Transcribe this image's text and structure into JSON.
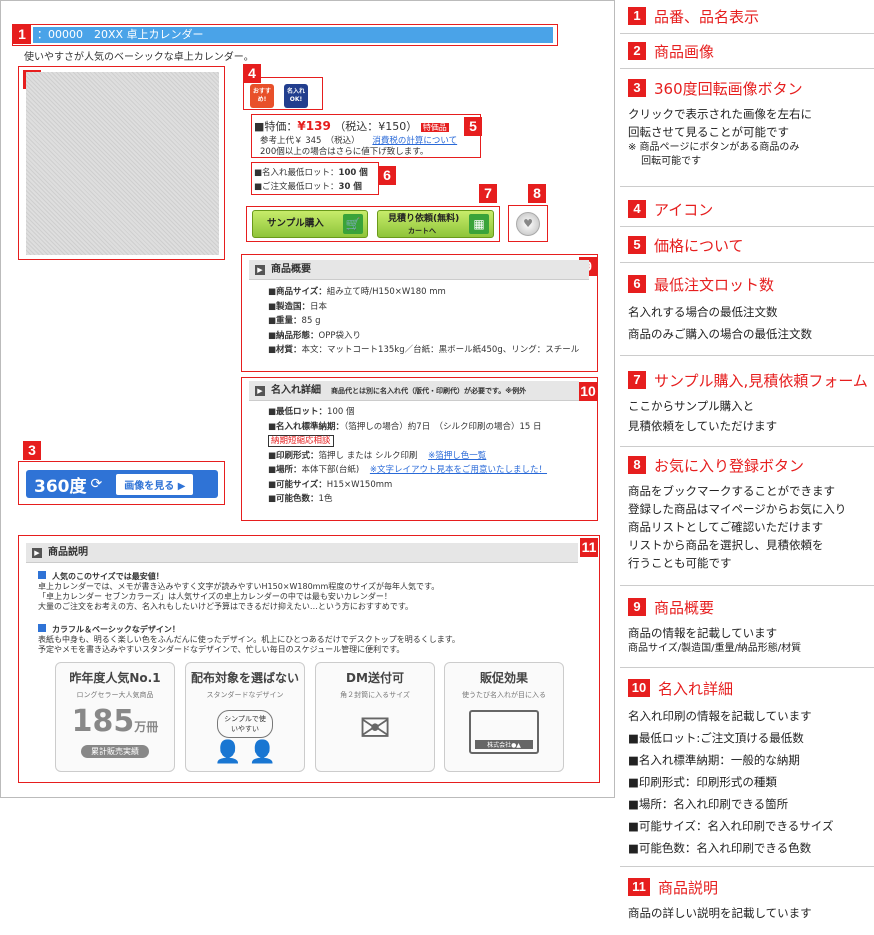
{
  "product": {
    "title": "：00000　20XX 卓上カレンダー",
    "subtitle": "使いやすさが人気のベーシックな卓上カレンダー。",
    "icons": [
      {
        "name": "osusume",
        "text": "おすすめ!"
      },
      {
        "name": "naire-ok",
        "text": "名入れOK!"
      }
    ],
    "price": {
      "label": "■特価：",
      "value": "¥139",
      "tax": "（税込：¥150）",
      "badge": "特価品",
      "ref": "参考上代￥ 345　（税込）",
      "link": "消費税の計算について",
      "note": "200個以上の場合はさらに値下げ致します。"
    },
    "lot": {
      "line1_label": "■名入れ最低ロット：",
      "line1_value": "100 個",
      "line2_label": "■ご注文最低ロット：",
      "line2_value": "30 個"
    },
    "sample_button": "サンプル購入",
    "estimate_button_l1": "見積り依頼(無料)",
    "estimate_button_l2": "カートへ",
    "rotate": {
      "degree": "360度",
      "link": "画像を見る ▶"
    },
    "overview": {
      "heading": "商品概要",
      "rows": [
        {
          "k": "■商品サイズ：",
          "v": "組み立て時/H150×W180 mm"
        },
        {
          "k": "■製造国：",
          "v": "日本"
        },
        {
          "k": "■重量：",
          "v": "85 g"
        },
        {
          "k": "■納品形態：",
          "v": "OPP袋入り"
        },
        {
          "k": "■材質：",
          "v": "本文：マットコート135kg／台紙：黒ボール紙450g、リング：スチール"
        }
      ]
    },
    "naire": {
      "heading": "名入れ詳細",
      "heading_note": "商品代とは別に名入れ代（版代・印刷代）が必要です。※例外",
      "rows": [
        {
          "k": "■最低ロット：",
          "v": "100 個"
        },
        {
          "k": "■名入れ標準納期：",
          "v": "（箔押しの場合）約7日　（シルク印刷の場合）15 日"
        },
        {
          "k": "",
          "v": "納期短縮応相談"
        },
        {
          "k": "■印刷形式：",
          "v": "箔押し または シルク印刷",
          "link": "※箔押し色一覧"
        },
        {
          "k": "■場所：",
          "v": "本体下部(台紙)",
          "link": "※文字レイアウト見本をご用意いたしました！"
        },
        {
          "k": "■可能サイズ：",
          "v": "H15×W150mm"
        },
        {
          "k": "■可能色数：",
          "v": "1色"
        }
      ]
    },
    "description": {
      "heading": "商品説明",
      "p1_title": "人気のこのサイズでは最安値！",
      "p1_lines": [
        "卓上カレンダーでは、メモが書き込みやすく文字が読みやすいH150×W180mm程度のサイズが毎年人気です。",
        "「卓上カレンダー セブンカラーズ」は人気サイズの卓上カレンダーの中では最も安いカレンダー！",
        "大量のご注文をお考えの方、名入れもしたいけど予算はできるだけ抑えたい…という方におすすめです。"
      ],
      "p2_title": "カラフル＆ベーシックなデザイン！",
      "p2_lines": [
        "表紙も中身も、明るく楽しい色をふんだんに使ったデザイン。机上にひとつあるだけでデスクトップを明るくします。",
        "予定やメモを書き込みやすいスタンダードなデザインで、忙しい毎日のスケジュール管理に便利です。"
      ],
      "features": [
        {
          "title": "昨年度人気No.1",
          "sub": "ロングセラー大人気商品",
          "big": "185",
          "unit": "万冊",
          "foot": "累計販売実績"
        },
        {
          "title": "配布対象を選ばない",
          "sub": "スタンダードなデザイン",
          "bubble": "シンプルで使いやすい"
        },
        {
          "title": "DM送付可",
          "sub": "角２封筒に入るサイズ"
        },
        {
          "title": "販促効果",
          "sub": "使うたび名入れが目に入る",
          "stamp": "株式会社●▲"
        }
      ]
    }
  },
  "markers": [
    "1",
    "2",
    "3",
    "4",
    "5",
    "6",
    "7",
    "8",
    "9",
    "10",
    "11"
  ],
  "sidebar": [
    {
      "n": "1",
      "title": "品番、品名表示",
      "lines": []
    },
    {
      "n": "2",
      "title": "商品画像",
      "lines": []
    },
    {
      "n": "3",
      "title": "360度回転画像ボタン",
      "lines": [
        "クリックで表示された画像を左右に",
        "回転させて見ることが可能です"
      ],
      "small": [
        "※ 商品ページにボタンがある商品のみ",
        "　 回転可能です"
      ]
    },
    {
      "n": "4",
      "title": "アイコン",
      "lines": []
    },
    {
      "n": "5",
      "title": "価格について",
      "lines": []
    },
    {
      "n": "6",
      "title": "最低注文ロット数",
      "lines": [
        "名入れする場合の最低注文数",
        "商品のみご購入の場合の最低注文数"
      ]
    },
    {
      "n": "7",
      "title": "サンプル購入,見積依頼フォーム",
      "lines": [
        "ここからサンプル購入と",
        "見積依頼をしていただけます"
      ]
    },
    {
      "n": "8",
      "title": "お気に入り登録ボタン",
      "lines": [
        "商品をブックマークすることができます",
        "登録した商品はマイページからお気に入り",
        "商品リストとしてご確認いただけます",
        "リストから商品を選択し、見積依頼を",
        "行うことも可能です"
      ]
    },
    {
      "n": "9",
      "title": "商品概要",
      "lines": [
        "商品の情報を記載しています"
      ],
      "small": [
        "商品サイズ/製造国/重量/納品形態/材質"
      ]
    },
    {
      "n": "10",
      "title": "名入れ詳細",
      "lines": [
        "名入れ印刷の情報を記載しています",
        "■最低ロット:ご注文頂ける最低数",
        "■名入れ標準納期：一般的な納期",
        "■印刷形式：印刷形式の種類",
        "■場所：名入れ印刷できる箇所",
        "■可能サイズ：名入れ印刷できるサイズ",
        "■可能色数：名入れ印刷できる色数"
      ]
    },
    {
      "n": "11",
      "title": "商品説明",
      "lines": [
        "商品の詳しい説明を記載しています"
      ]
    }
  ],
  "colors": {
    "accent": "#e61e1e",
    "title_bar": "#4aa3e8",
    "button_green": "#8ec43a"
  }
}
